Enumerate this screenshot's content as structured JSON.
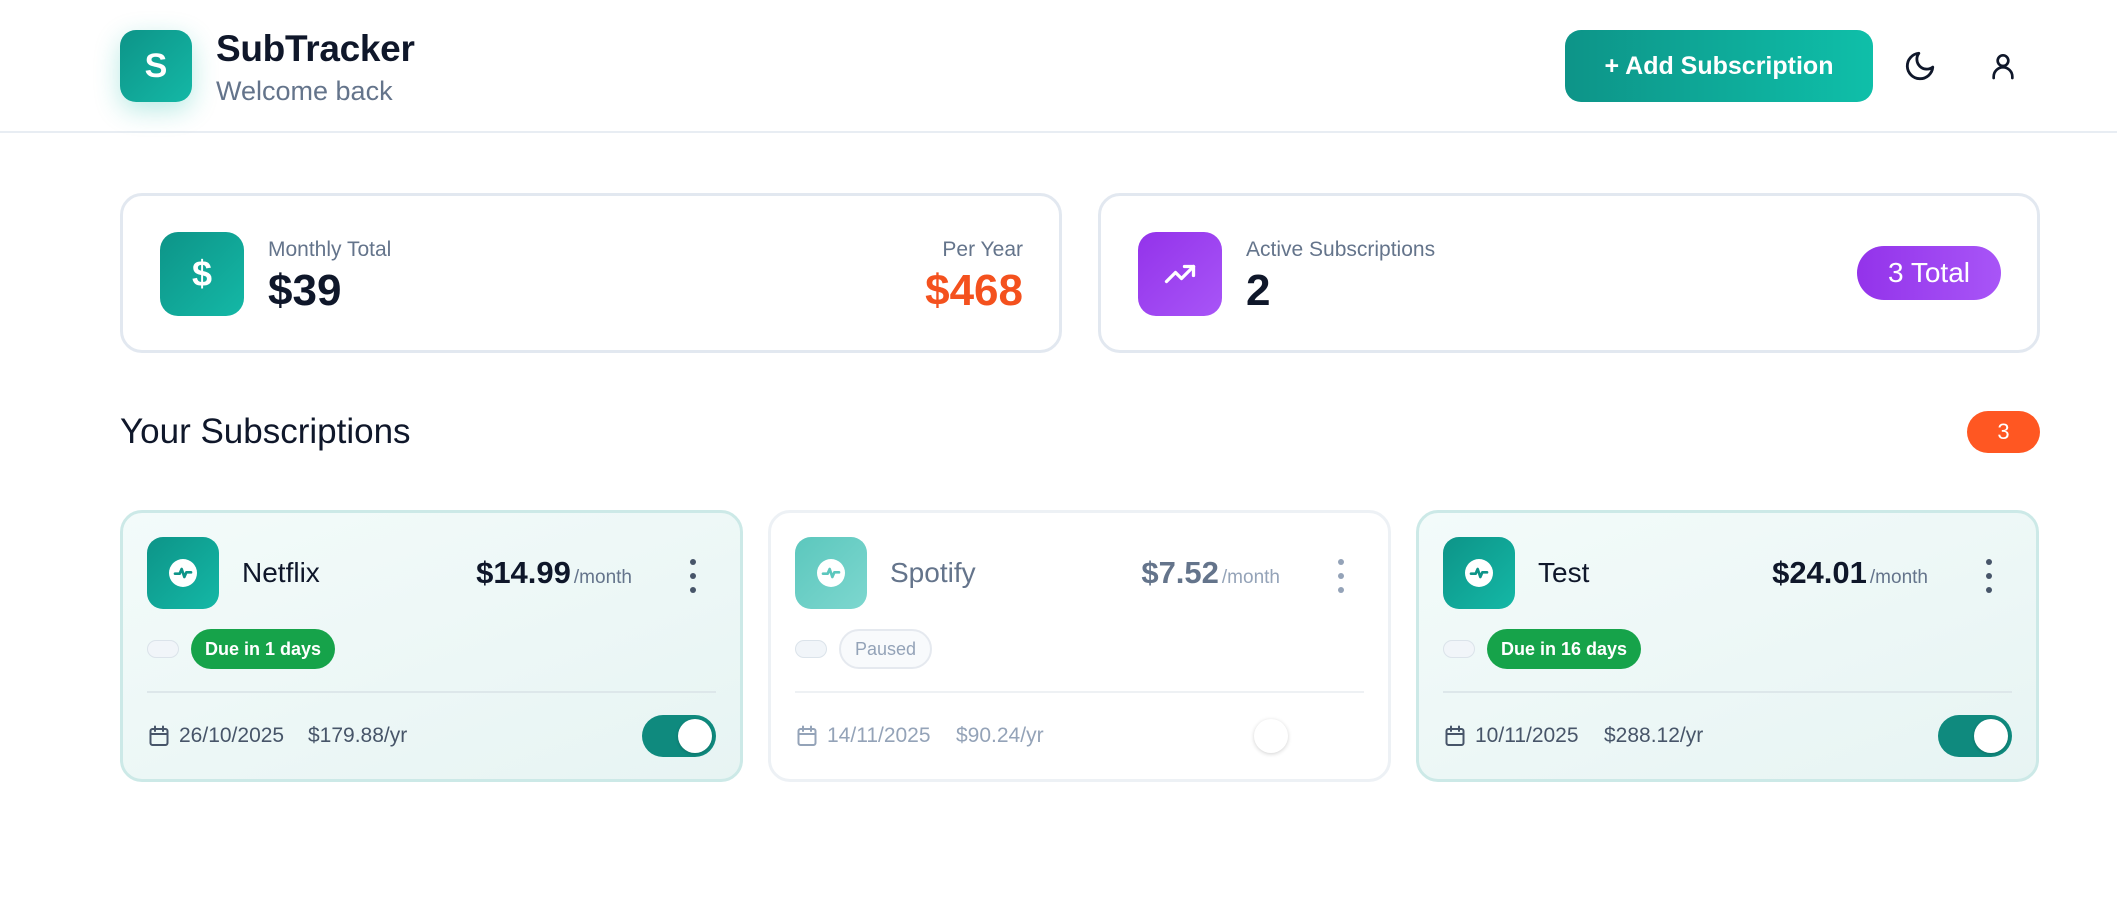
{
  "header": {
    "logo_letter": "S",
    "title": "SubTracker",
    "subtitle": "Welcome back",
    "add_button": "+ Add Subscription",
    "theme_icon": "moon-icon",
    "profile_icon": "user-icon"
  },
  "stats": {
    "monthly": {
      "icon": "dollar-icon",
      "label": "Monthly Total",
      "value": "$39",
      "year_label": "Per Year",
      "year_value": "$468"
    },
    "active": {
      "icon": "trending-up-icon",
      "label": "Active Subscriptions",
      "value": "2",
      "total_badge": "3 Total"
    }
  },
  "section": {
    "title": "Your Subscriptions",
    "count": "3"
  },
  "subscriptions": [
    {
      "name": "Netflix",
      "price": "$14.99",
      "period": "/month",
      "status": "Due in 1 days",
      "date": "26/10/2025",
      "yearly": "$179.88/yr",
      "active": true
    },
    {
      "name": "Spotify",
      "price": "$7.52",
      "period": "/month",
      "status": "Paused",
      "date": "14/11/2025",
      "yearly": "$90.24/yr",
      "active": false
    },
    {
      "name": "Test",
      "price": "$24.01",
      "period": "/month",
      "status": "Due in 16 days",
      "date": "10/11/2025",
      "yearly": "$288.12/yr",
      "active": true
    }
  ],
  "colors": {
    "primary": "#0d9488",
    "accent_orange": "#f4511e",
    "purple": "#9333ea",
    "due_green": "#16a34a"
  }
}
